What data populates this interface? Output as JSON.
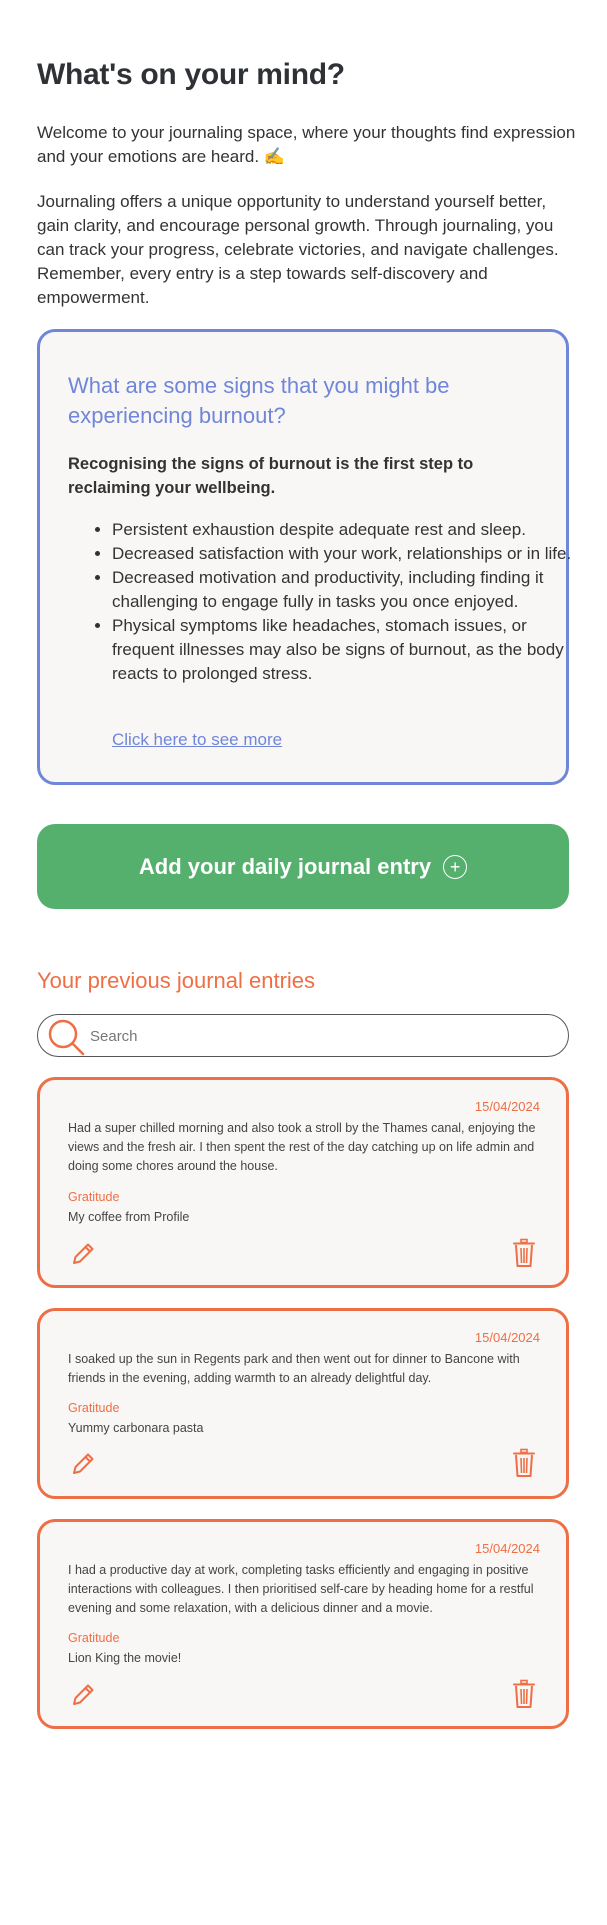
{
  "header": {
    "title": "What's on your mind?",
    "intro": "Welcome to your journaling space, where your thoughts find expression and your emotions are heard. ✍️",
    "description": "Journaling offers a unique opportunity to understand yourself better, gain clarity, and encourage personal growth. Through journaling, you can track your progress, celebrate victories, and navigate challenges. Remember, every entry is a step towards self-discovery and empowerment."
  },
  "burnout": {
    "question": "What are some signs that you might be experiencing burnout?",
    "lead": "Recognising the signs of burnout is the first step to reclaiming your wellbeing.",
    "signs": [
      "Persistent exhaustion despite adequate rest and sleep.",
      "Decreased satisfaction with your work, relationships or in life.",
      "Decreased motivation and productivity, including finding it challenging to engage fully in tasks you once enjoyed.",
      "Physical symptoms like headaches, stomach issues, or frequent illnesses may also be signs of burnout, as the body reacts to prolonged stress."
    ],
    "link": "Click here to see more"
  },
  "add_entry": {
    "label": "Add your daily journal entry",
    "icon": "plus-circle-icon"
  },
  "entries_section": {
    "title": "Your previous journal entries",
    "search_placeholder": "Search",
    "search_value": ""
  },
  "entries": [
    {
      "date": "15/04/2024",
      "text": "Had a super chilled morning and also took a stroll by the Thames canal, enjoying the views and the fresh air. I then spent the rest of the day catching up on life admin and doing some chores around the house.",
      "gratitude_label": "Gratitude",
      "gratitude": "My coffee from Profile"
    },
    {
      "date": "15/04/2024",
      "text": "I soaked up the sun in Regents park and then went out for dinner to Bancone with friends in the evening, adding warmth to an already delightful day.",
      "gratitude_label": "Gratitude",
      "gratitude": "Yummy carbonara pasta"
    },
    {
      "date": "15/04/2024",
      "text": "I had a productive day at work, completing tasks efficiently and engaging in positive interactions with colleagues. I then prioritised self-care by heading home for a restful evening and some relaxation, with a delicious dinner and a movie.",
      "gratitude_label": "Gratitude",
      "gratitude": "Lion King the movie!"
    }
  ],
  "colors": {
    "accent_blue": "#6f86d9",
    "accent_green": "#55b06e",
    "accent_orange": "#ee6f45",
    "card_bg": "#f9f7f5"
  }
}
